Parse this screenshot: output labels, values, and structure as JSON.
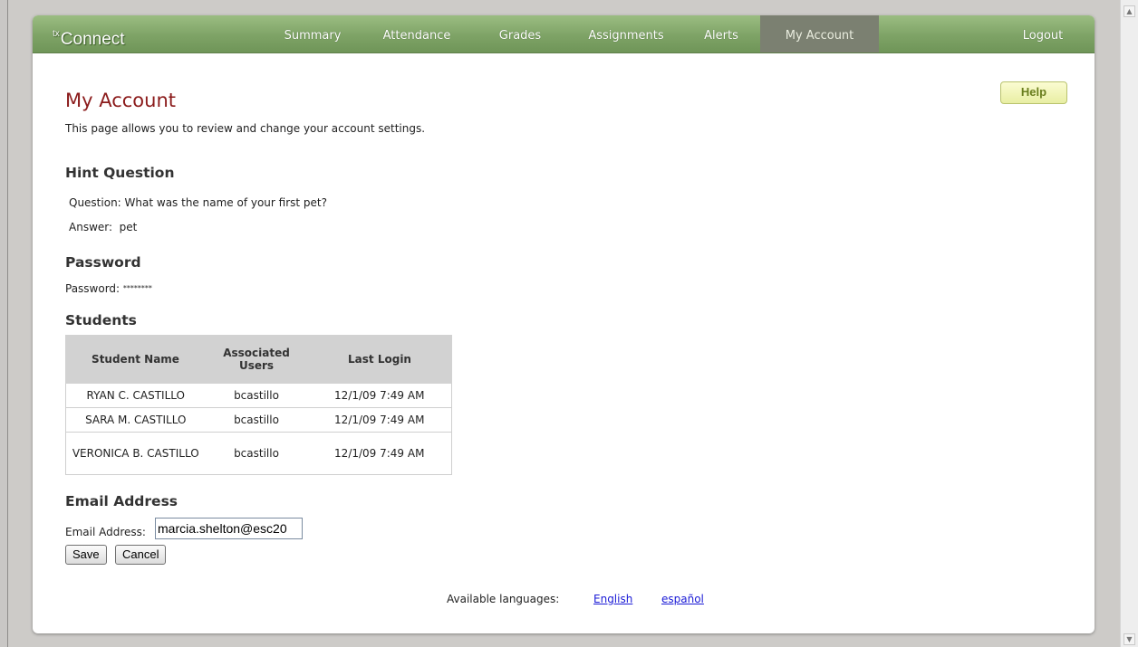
{
  "app": {
    "logo_prefix": "tx",
    "logo_text": "Connect"
  },
  "nav": {
    "items": [
      {
        "label": "Summary"
      },
      {
        "label": "Attendance"
      },
      {
        "label": "Grades"
      },
      {
        "label": "Assignments"
      },
      {
        "label": "Alerts"
      },
      {
        "label": "My Account",
        "active": true
      }
    ],
    "logout": "Logout"
  },
  "help_label": "Help",
  "page": {
    "title": "My Account",
    "intro": "This page allows you to review and change your account settings."
  },
  "hint": {
    "heading": "Hint Question",
    "question_label": "Question:",
    "question": "What was the name of your first pet?",
    "answer_label": "Answer:",
    "answer": "pet"
  },
  "password": {
    "heading": "Password",
    "label": "Password:",
    "mask": "********"
  },
  "students": {
    "heading": "Students",
    "columns": [
      "Student Name",
      "Associated Users",
      "Last Login"
    ],
    "rows": [
      {
        "name": "RYAN C. CASTILLO",
        "users": "bcastillo",
        "last_login": "12/1/09 7:49 AM"
      },
      {
        "name": "SARA M. CASTILLO",
        "users": "bcastillo",
        "last_login": "12/1/09 7:49 AM"
      },
      {
        "name": "VERONICA B. CASTILLO",
        "users": "bcastillo",
        "last_login": "12/1/09 7:49 AM"
      }
    ]
  },
  "email": {
    "heading": "Email Address",
    "label": "Email Address:",
    "value": "marcia.shelton@esc20"
  },
  "buttons": {
    "save": "Save",
    "cancel": "Cancel"
  },
  "languages": {
    "label": "Available languages:",
    "english": "English",
    "spanish": "español"
  },
  "colors": {
    "nav_green": "#7ea366",
    "nav_active": "#7b8071",
    "title_red": "#8b1b1b",
    "link_blue": "#1a1ad6",
    "help_yellow": "#f4f7c0"
  }
}
